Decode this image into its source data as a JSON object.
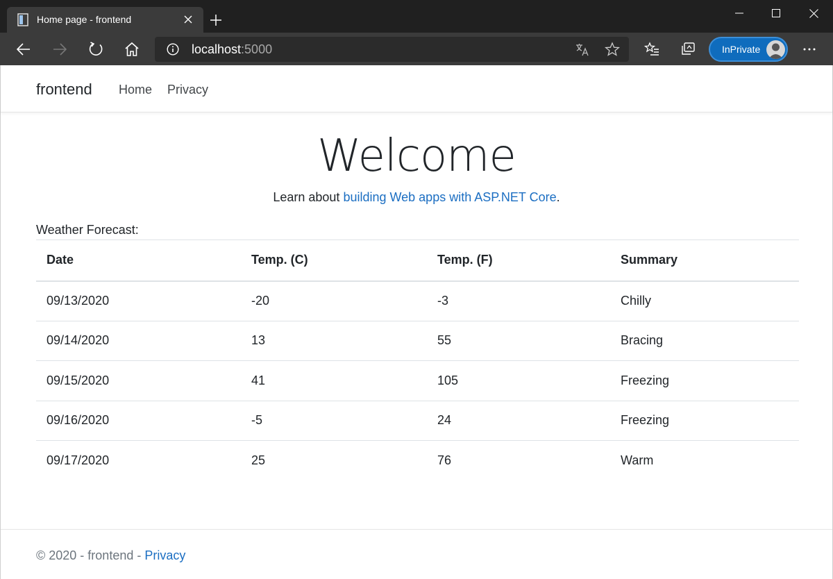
{
  "browser": {
    "tab_title": "Home page - frontend",
    "url_host": "localhost",
    "url_port": ":5000",
    "profile_label": "InPrivate"
  },
  "site": {
    "brand": "frontend",
    "nav": {
      "home": "Home",
      "privacy": "Privacy"
    },
    "heading": "Welcome",
    "intro_prefix": "Learn about ",
    "intro_link": "building Web apps with ASP.NET Core",
    "intro_suffix": ".",
    "forecast_label": "Weather Forecast:",
    "table": {
      "headers": [
        "Date",
        "Temp. (C)",
        "Temp. (F)",
        "Summary"
      ],
      "rows": [
        [
          "09/13/2020",
          "-20",
          "-3",
          "Chilly"
        ],
        [
          "09/14/2020",
          "13",
          "55",
          "Bracing"
        ],
        [
          "09/15/2020",
          "41",
          "105",
          "Freezing"
        ],
        [
          "09/16/2020",
          "-5",
          "24",
          "Freezing"
        ],
        [
          "09/17/2020",
          "25",
          "76",
          "Warm"
        ]
      ]
    },
    "footer": {
      "text": "© 2020 - frontend - ",
      "link": "Privacy"
    }
  },
  "colors": {
    "link": "#1b6ec2",
    "chrome_dark": "#202020",
    "chrome_toolbar": "#3b3b3b",
    "inprivate": "#0f6cbd"
  }
}
